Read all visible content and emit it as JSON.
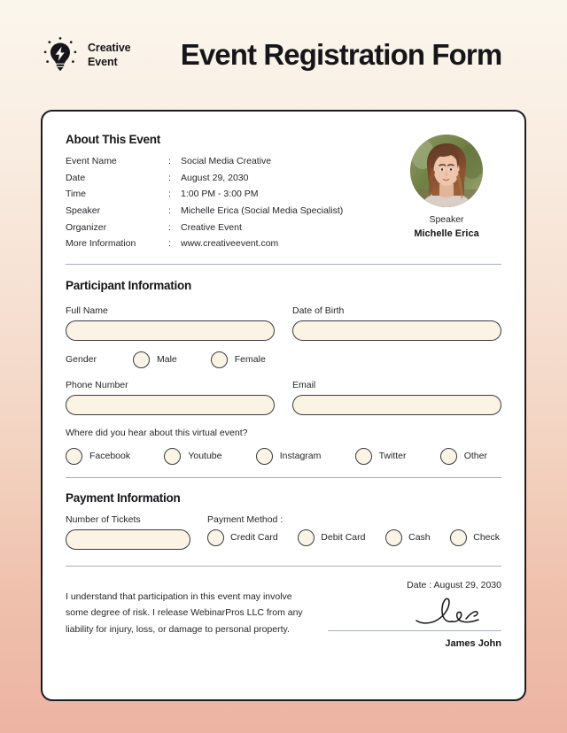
{
  "colors": {
    "ink": "#16161A",
    "field_fill": "#FBF3E4",
    "field_border": "#3A3A3F",
    "divider": "#A9B0B9",
    "bg_top": "#FBF6ED",
    "bg_bottom": "#EDB4A3",
    "card_bg": "#FFFFFF"
  },
  "header": {
    "logo_icon": "lightbulb-idea-icon",
    "brand_line1": "Creative",
    "brand_line2": "Event",
    "title": "Event Registration Form"
  },
  "about": {
    "title": "About This Event",
    "separator": ":",
    "rows": [
      {
        "label": "Event Name",
        "value": "Social Media Creative"
      },
      {
        "label": "Date",
        "value": "August 29, 2030"
      },
      {
        "label": "Time",
        "value": "1:00 PM - 3:00 PM"
      },
      {
        "label": "Speaker",
        "value": "Michelle Erica (Social Media Specialist)"
      },
      {
        "label": "Organizer",
        "value": "Creative Event"
      },
      {
        "label": "More Information",
        "value": "www.creativeevent.com"
      }
    ],
    "speaker": {
      "photo_alt": "speaker-portrait",
      "role": "Speaker",
      "name": "Michelle Erica"
    }
  },
  "participant": {
    "title": "Participant Information",
    "full_name": {
      "label": "Full Name",
      "value": "",
      "placeholder": ""
    },
    "date_of_birth": {
      "label": "Date of Birth",
      "value": "",
      "placeholder": ""
    },
    "gender": {
      "label": "Gender",
      "options": [
        "Male",
        "Female"
      ],
      "selected": ""
    },
    "phone_number": {
      "label": "Phone Number",
      "value": "",
      "placeholder": ""
    },
    "email": {
      "label": "Email",
      "value": "",
      "placeholder": ""
    },
    "referral": {
      "question": "Where did you hear about this virtual event?",
      "options": [
        "Facebook",
        "Youtube",
        "Instagram",
        "Twitter",
        "Other"
      ],
      "selected": ""
    }
  },
  "payment": {
    "title": "Payment Information",
    "tickets": {
      "label": "Number of Tickets",
      "value": "",
      "placeholder": ""
    },
    "method": {
      "label": "Payment Method :",
      "options": [
        "Credit Card",
        "Debit Card",
        "Cash",
        "Check"
      ],
      "selected": ""
    }
  },
  "footer": {
    "disclaimer_line1": "I understand that participation in this event may involve",
    "disclaimer_line2": "some degree of risk. I release WebinarPros LLC from any",
    "disclaimer_line3": "liability for injury, loss, or damage to personal property.",
    "date_label": "Date : August 29, 2030",
    "signature_alt": "handwritten-signature",
    "signer_name": "James John"
  }
}
